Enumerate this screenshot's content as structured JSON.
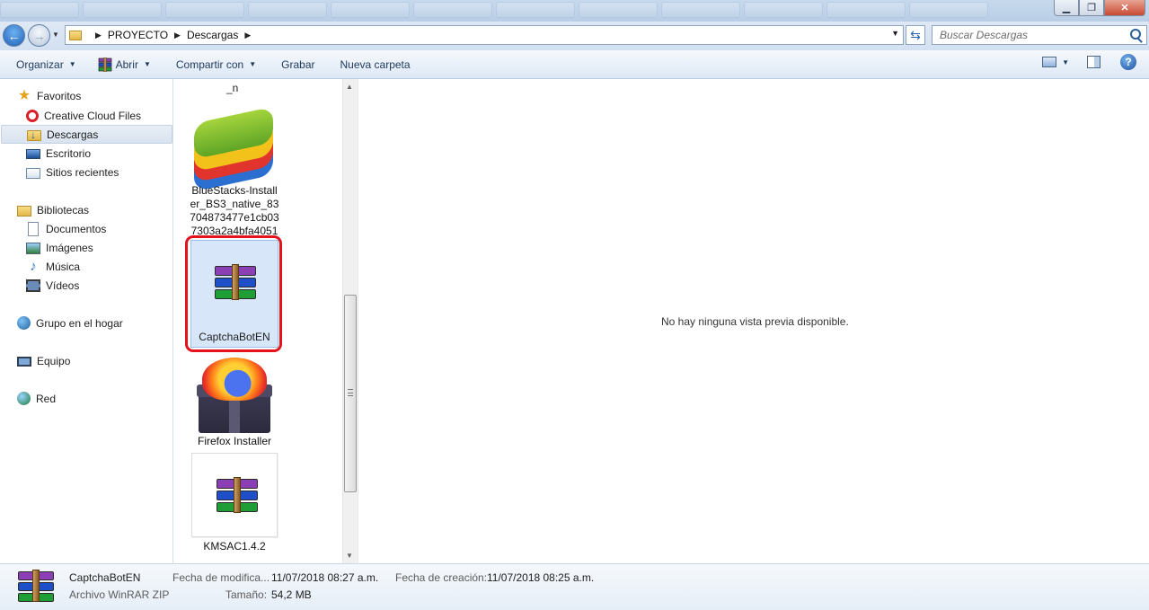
{
  "breadcrumb": [
    "PROYECTO",
    "Descargas"
  ],
  "search": {
    "placeholder": "Buscar Descargas"
  },
  "toolbar": {
    "organize": "Organizar",
    "open": "Abrir",
    "share": "Compartir con",
    "burn": "Grabar",
    "new_folder": "Nueva carpeta"
  },
  "sidebar": {
    "favorites": "Favoritos",
    "favorites_items": [
      "Creative Cloud Files",
      "Descargas",
      "Escritorio",
      "Sitios recientes"
    ],
    "libraries": "Bibliotecas",
    "library_items": [
      "Documentos",
      "Imágenes",
      "Música",
      "Vídeos"
    ],
    "homegroup": "Grupo en el hogar",
    "computer": "Equipo",
    "network": "Red"
  },
  "files": {
    "truncated_label": "_n",
    "items": [
      {
        "name": "BlueStacks-Install er_BS3_native_83 704873477e1cb03 7303a2a4bfa4051",
        "icon": "bluestacks-icon"
      },
      {
        "name": "CaptchaBotEN",
        "icon": "winrar-archive-icon",
        "selected": true
      },
      {
        "name": "Firefox Installer",
        "icon": "firefox-installer-icon"
      },
      {
        "name": "KMSAC1.4.2",
        "icon": "winrar-archive-icon"
      }
    ]
  },
  "preview": {
    "message": "No hay ninguna vista previa disponible."
  },
  "details": {
    "name": "CaptchaBotEN",
    "type": "Archivo WinRAR ZIP",
    "modified_label": "Fecha de modifica...",
    "modified_value": "11/07/2018 08:27 a.m.",
    "size_label": "Tamaño:",
    "size_value": "54,2 MB",
    "created_label": "Fecha de creación:",
    "created_value": "11/07/2018 08:25 a.m."
  },
  "colors": {
    "highlight_ring": "#e3131d",
    "selection": "#d7e6f9"
  }
}
